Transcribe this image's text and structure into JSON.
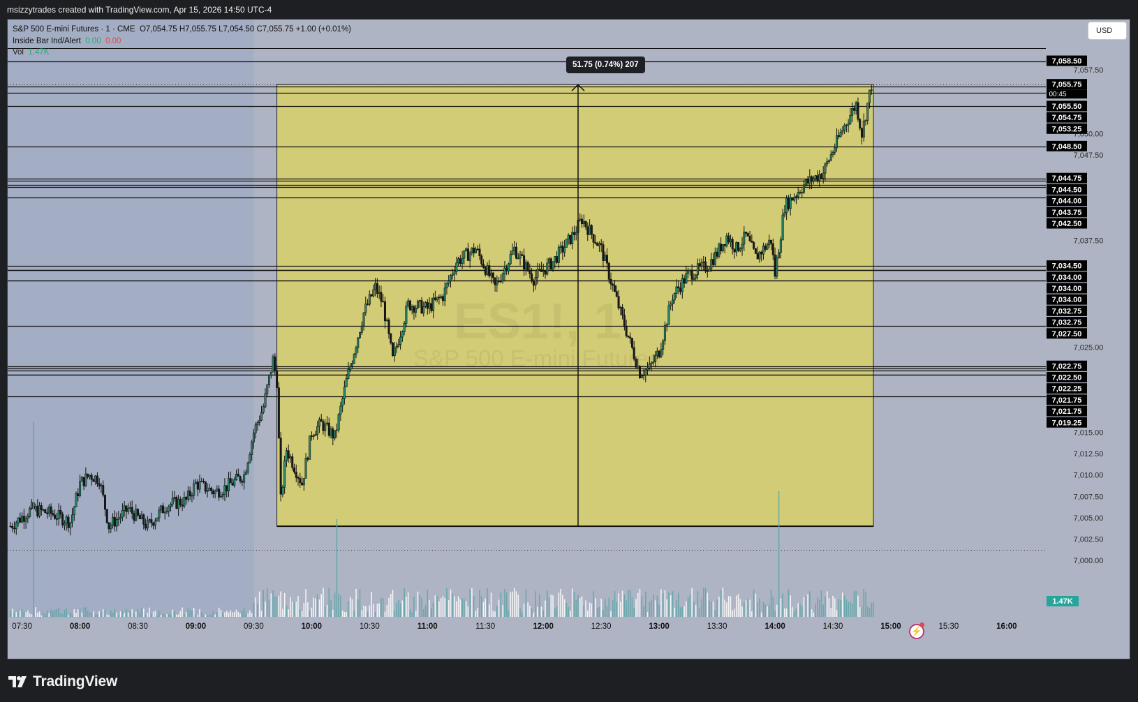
{
  "attribution": "msizzytrades created with TradingView.com, Apr 15, 2026 14:50 UTC-4",
  "brand": "TradingView",
  "currency": "USD",
  "legend": {
    "symbol_line": "S&P 500 E-mini Futures · 1 · CME",
    "ohlc": "O7,054.75  H7,055.75  L7,054.50  C7,055.75  +1.00 (+0.01%)",
    "indicator": "Inside Bar Ind/Alert",
    "indicator_v1": "0.00",
    "indicator_v2": "0.00",
    "volume_label": "Vol",
    "volume_value": "1.47K"
  },
  "watermark": {
    "ticker": "ES1!, 1",
    "name": "S&P 500 E-mini Futures"
  },
  "measure_label": "51.75 (0.74%) 207",
  "icons": {
    "logo": "tradingview-logo-icon",
    "alert": "lightning-alert-icon"
  },
  "colors": {
    "background": "#aeb4c4",
    "session_shade": "#9aa8c4",
    "range_box": "#d8cf6e",
    "bull": "#2a8a6a",
    "bear": "#1a1a1a",
    "volume": "#ffffff",
    "volume_dim": "#5fa5a8",
    "badge": "#000000",
    "volume_badge": "#26a69a"
  },
  "chart_data": {
    "type": "candlestick",
    "x_axis": {
      "ticks": [
        "07:30",
        "08:00",
        "08:30",
        "09:00",
        "09:30",
        "10:00",
        "10:30",
        "11:00",
        "11:30",
        "12:00",
        "12:30",
        "13:00",
        "13:30",
        "14:00",
        "14:30",
        "15:00",
        "15:30",
        "16:00"
      ],
      "bold_ticks": [
        "08:00",
        "09:00",
        "10:00",
        "11:00",
        "12:00",
        "13:00",
        "14:00",
        "15:00",
        "16:00"
      ],
      "range": [
        "07:24",
        "16:08"
      ]
    },
    "y_axis": {
      "range": [
        6997.3,
        7061.0
      ],
      "ticks": [
        7000.0,
        7002.5,
        7005.0,
        7007.5,
        7010.0,
        7012.5,
        7015.0,
        7025.0,
        7037.5,
        7047.5,
        7050.0,
        7057.5
      ]
    },
    "horizontal_levels": [
      7058.5,
      7055.5,
      7054.75,
      7053.25,
      7048.5,
      7044.75,
      7044.5,
      7044.0,
      7043.75,
      7042.5,
      7034.5,
      7034.0,
      7034.0,
      7034.0,
      7032.75,
      7032.75,
      7027.5,
      7022.75,
      7022.5,
      7022.25,
      7021.75,
      7021.75,
      7019.25
    ],
    "top_lines": [
      7060.0,
      7058.5
    ],
    "price_badges": [
      "7,058.50",
      "7,055.75",
      "7,055.50",
      "7,054.75",
      "7,053.25",
      "7,048.50",
      "7,044.75",
      "7,044.50",
      "7,044.00",
      "7,043.75",
      "7,042.50",
      "7,034.50",
      "7,034.00",
      "7,034.00",
      "7,034.00",
      "7,032.75",
      "7,032.75",
      "7,027.50",
      "7,022.75",
      "7,022.50",
      "7,022.25",
      "7,021.75",
      "7,021.75",
      "7,019.25"
    ],
    "last_price": {
      "value": 7055.75,
      "label": "7,055.75",
      "countdown": "00:45"
    },
    "volume_badge": "1.47K",
    "price_path": [
      [
        "07:24",
        7004.0
      ],
      [
        "07:35",
        7006.0
      ],
      [
        "07:45",
        7005.5
      ],
      [
        "07:55",
        7004.5
      ],
      [
        "08:00",
        7009.0
      ],
      [
        "08:05",
        7010.0
      ],
      [
        "08:10",
        7009.5
      ],
      [
        "08:15",
        7004.0
      ],
      [
        "08:25",
        7006.0
      ],
      [
        "08:35",
        7004.0
      ],
      [
        "08:45",
        7006.5
      ],
      [
        "08:55",
        7007.0
      ],
      [
        "09:00",
        7009.0
      ],
      [
        "09:10",
        7008.0
      ],
      [
        "09:15",
        7008.5
      ],
      [
        "09:25",
        7010.0
      ],
      [
        "09:30",
        7015.0
      ],
      [
        "09:35",
        7018.0
      ],
      [
        "09:40",
        7023.5
      ],
      [
        "09:42",
        7021.0
      ],
      [
        "09:44",
        7007.0
      ],
      [
        "09:47",
        7013.0
      ],
      [
        "09:55",
        7009.0
      ],
      [
        "10:00",
        7015.0
      ],
      [
        "10:05",
        7016.0
      ],
      [
        "10:12",
        7014.5
      ],
      [
        "10:18",
        7021.0
      ],
      [
        "10:27",
        7029.0
      ],
      [
        "10:33",
        7032.0
      ],
      [
        "10:37",
        7030.0
      ],
      [
        "10:42",
        7023.5
      ],
      [
        "10:50",
        7030.0
      ],
      [
        "11:00",
        7029.5
      ],
      [
        "11:08",
        7031.0
      ],
      [
        "11:15",
        7035.0
      ],
      [
        "11:25",
        7036.5
      ],
      [
        "11:35",
        7032.0
      ],
      [
        "11:45",
        7036.5
      ],
      [
        "11:55",
        7033.0
      ],
      [
        "12:05",
        7035.0
      ],
      [
        "12:15",
        7038.0
      ],
      [
        "12:20",
        7040.0
      ],
      [
        "12:30",
        7036.5
      ],
      [
        "12:40",
        7029.0
      ],
      [
        "12:50",
        7022.0
      ],
      [
        "12:55",
        7022.5
      ],
      [
        "13:00",
        7024.5
      ],
      [
        "13:07",
        7031.0
      ],
      [
        "13:15",
        7033.5
      ],
      [
        "13:25",
        7034.5
      ],
      [
        "13:30",
        7036.0
      ],
      [
        "13:35",
        7038.0
      ],
      [
        "13:40",
        7036.5
      ],
      [
        "13:45",
        7038.0
      ],
      [
        "13:50",
        7035.5
      ],
      [
        "13:58",
        7037.5
      ],
      [
        "14:00",
        7033.5
      ],
      [
        "14:05",
        7041.5
      ],
      [
        "14:15",
        7044.0
      ],
      [
        "14:25",
        7045.5
      ],
      [
        "14:35",
        7050.5
      ],
      [
        "14:42",
        7053.5
      ],
      [
        "14:45",
        7050.0
      ],
      [
        "14:50",
        7055.75
      ]
    ],
    "range_box": {
      "x0": "09:42",
      "x1": "14:51",
      "y_low": 7004.0,
      "y_high": 7055.75
    },
    "measurement": {
      "x": "12:18",
      "y_from": 7004.0,
      "y_to": 7055.75,
      "change": 51.75,
      "percent": 0.74,
      "bars": 207
    },
    "session_start": "09:30",
    "dotted_lines": [
      7001.2,
      7055.75
    ]
  }
}
